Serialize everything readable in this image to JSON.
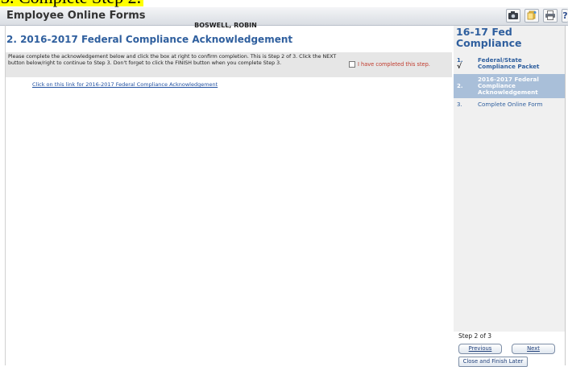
{
  "banner": {
    "text": "3. Complete Step 2."
  },
  "header": {
    "title": "Employee Online Forms",
    "help_label": "?"
  },
  "employee": {
    "name": "BOSWELL, ROBIN"
  },
  "main": {
    "title": "2. 2016-2017 Federal Compliance Acknowledgement",
    "instructions": "Please complete the acknowledgement below and click the box at right to confirm completion. This is Step 2 of 3. Click the NEXT button below/right to continue to Step 3. Don't forget to click the FINISH button when you complete Step 3.",
    "confirm_label": "I have completed this step.",
    "link_text": "Click on this link for 2016-2017 Federal Compliance Acknowledgement"
  },
  "sidebar": {
    "title": "16-17 Fed Compliance",
    "steps": [
      {
        "num": "1.",
        "label": "Federal/State Compliance Packet",
        "check": "√"
      },
      {
        "num": "2.",
        "label": "2016-2017 Federal Compliance Acknowledgement"
      },
      {
        "num": "3.",
        "label": "Complete Online Form"
      }
    ],
    "step_count": "Step 2 of 3",
    "previous_label": "Previous",
    "next_label": "Next",
    "close_label": "Close and Finish Later"
  }
}
